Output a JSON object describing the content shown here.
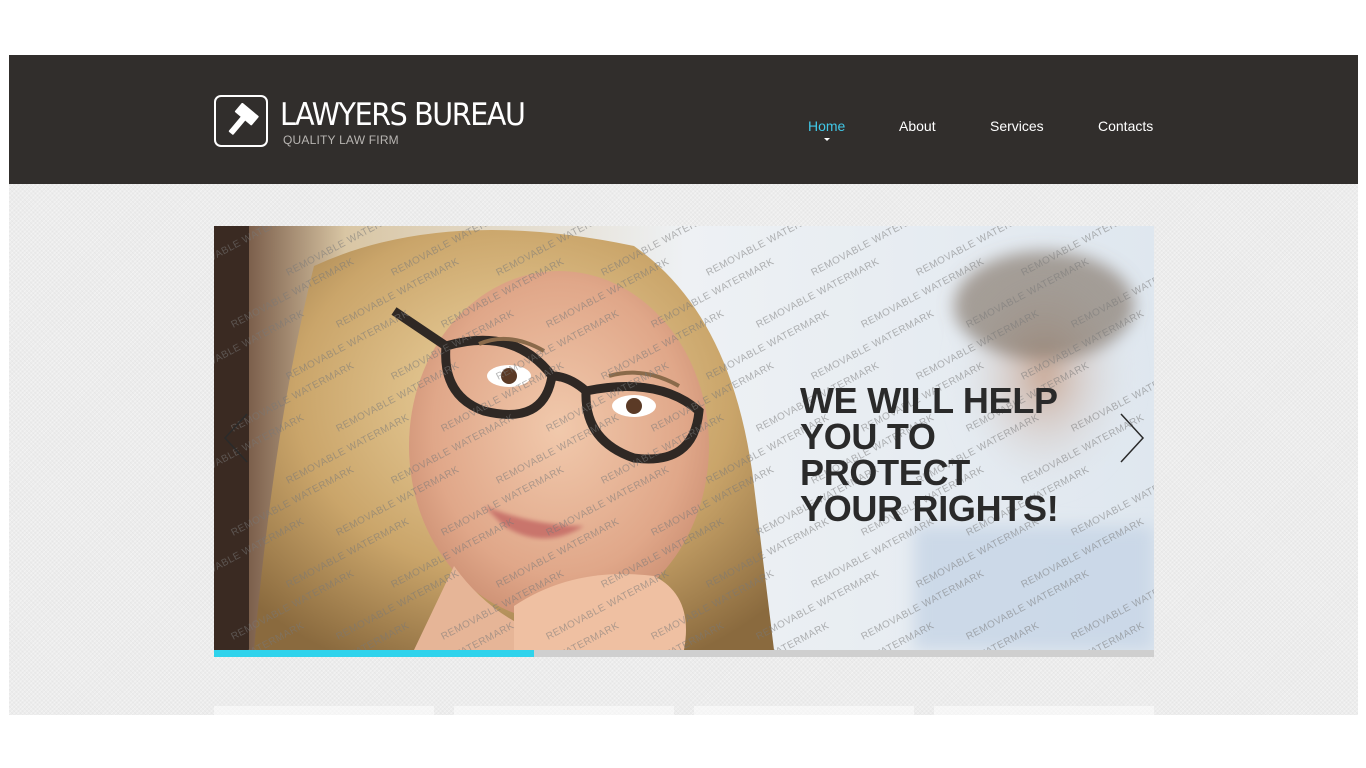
{
  "header": {
    "logo": {
      "title": "LAWYERS BUREAU",
      "tagline": "QUALITY LAW FIRM",
      "icon": "gavel-icon"
    },
    "nav": [
      {
        "label": "Home",
        "active": true
      },
      {
        "label": "About",
        "active": false
      },
      {
        "label": "Services",
        "active": false
      },
      {
        "label": "Contacts",
        "active": false
      }
    ]
  },
  "slider": {
    "caption": "WE WILL HELP\nYOU TO\nPROTECT\nYOUR RIGHTS!",
    "watermark": "REMOVABLE WATERMARK",
    "prev_icon": "chevron-left-icon",
    "next_icon": "chevron-right-icon",
    "progress": 0.34
  },
  "colors": {
    "header_bg": "#312e2c",
    "accent": "#41c8e8",
    "progress": "#2fd3ec",
    "page_bg": "#ececec"
  }
}
